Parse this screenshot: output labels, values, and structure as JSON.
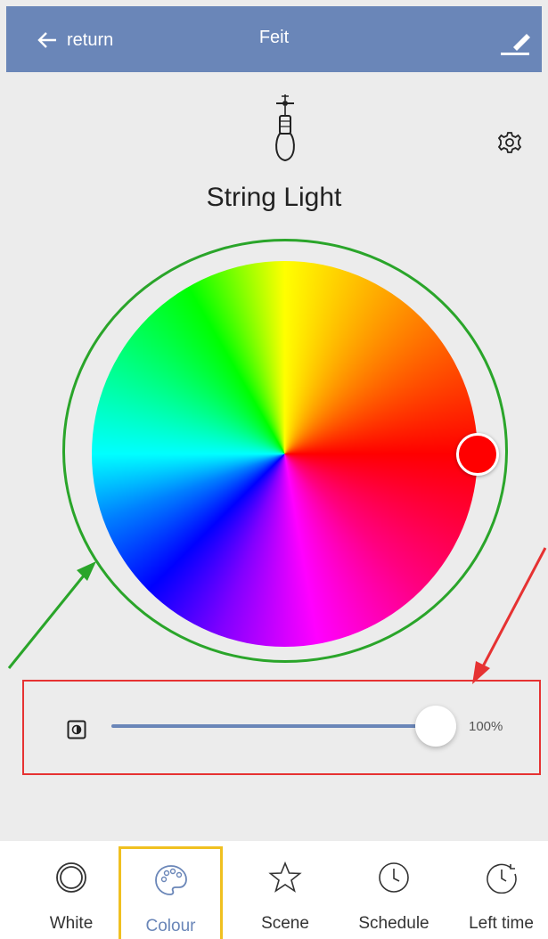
{
  "header": {
    "back_label": "return",
    "title": "Feit"
  },
  "device": {
    "name": "String Light"
  },
  "color_wheel": {
    "selected_color": "#ff0000",
    "ring_color": "#2aa52a"
  },
  "brightness": {
    "value_label": "100%",
    "value": 100
  },
  "tabs": [
    {
      "label": "White",
      "icon": "ring-icon"
    },
    {
      "label": "Colour",
      "icon": "palette-icon",
      "active": true
    },
    {
      "label": "Scene",
      "icon": "star-icon"
    },
    {
      "label": "Schedule",
      "icon": "clock-icon"
    },
    {
      "label": "Left time",
      "icon": "timer-icon"
    }
  ],
  "colors": {
    "header_bg": "#6a86b8",
    "accent": "#6a86b8",
    "active_tab_border": "#f0c020",
    "annotation_red": "#e63232",
    "annotation_green": "#2aa52a"
  }
}
